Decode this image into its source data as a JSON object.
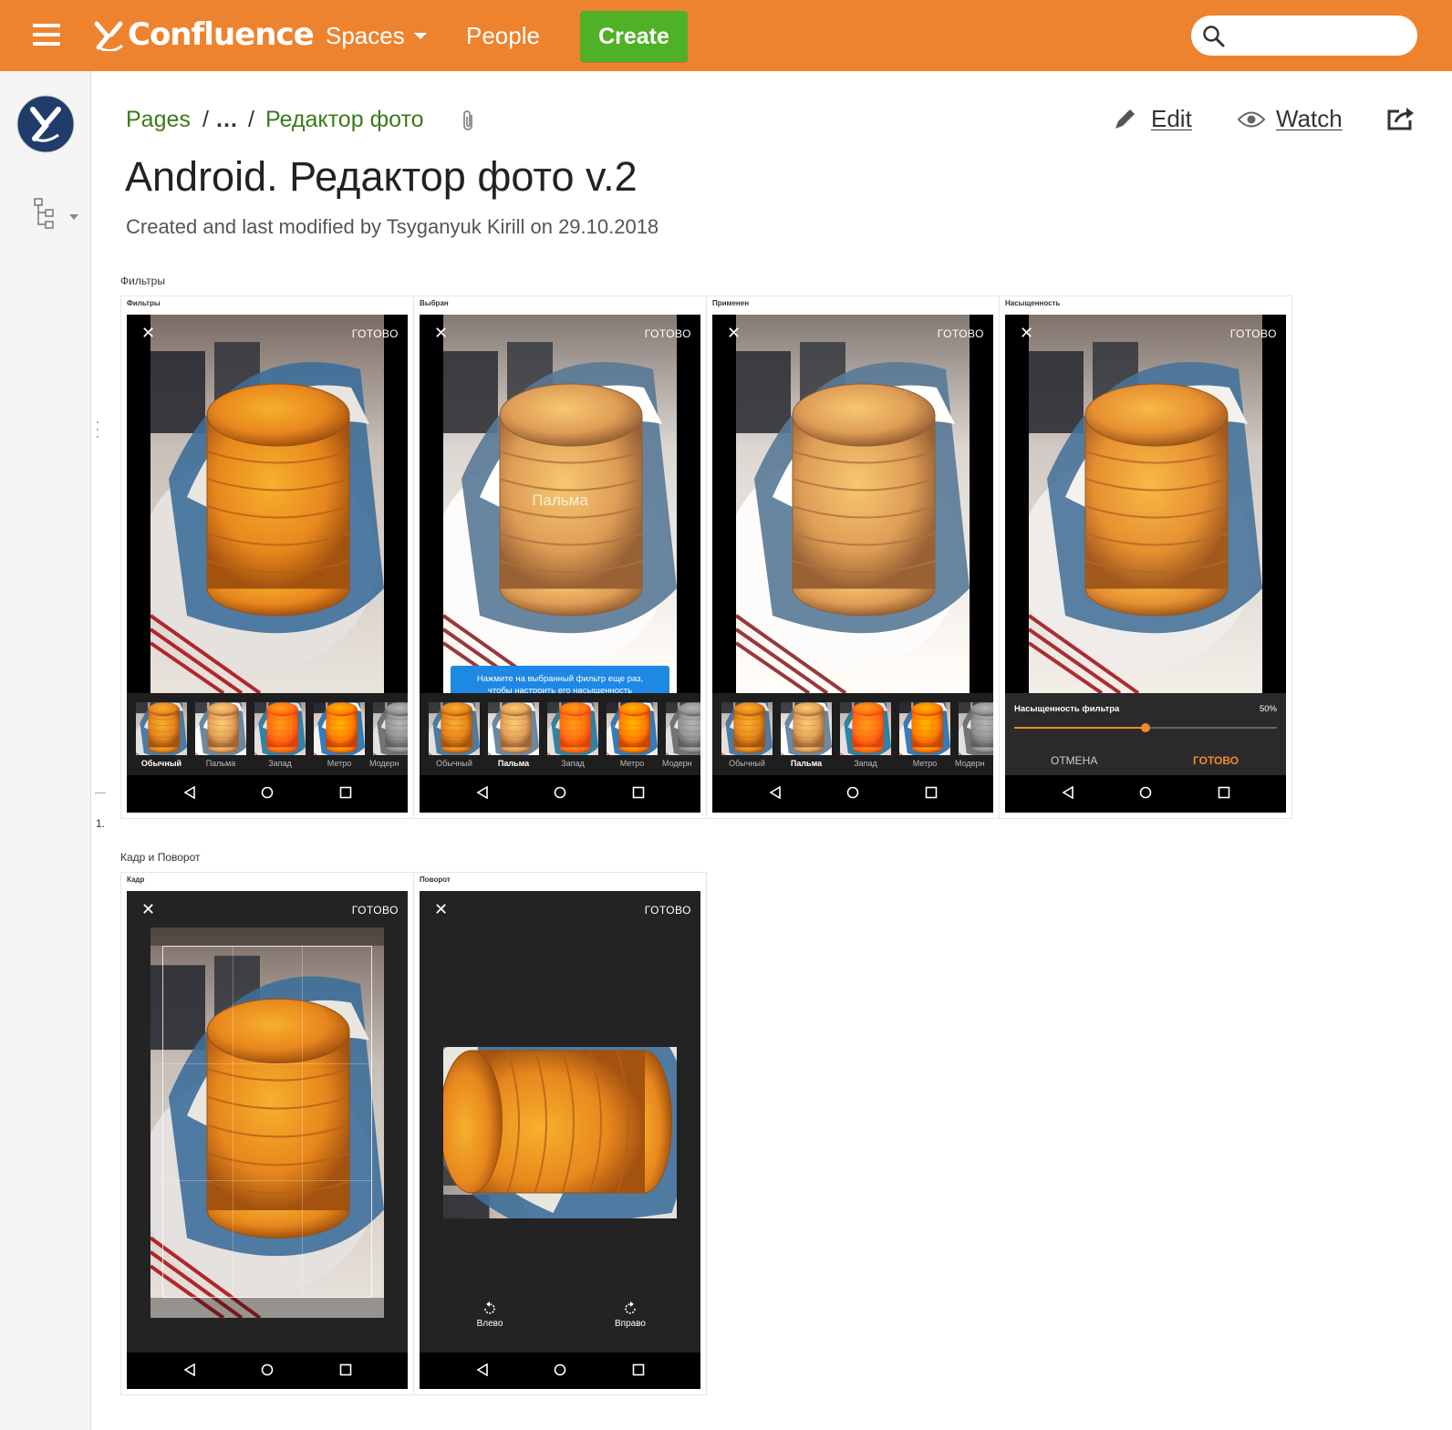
{
  "topbar": {
    "app_name": "Confluence",
    "nav": {
      "spaces": "Spaces",
      "people": "People"
    },
    "create_label": "Create",
    "search_placeholder": ""
  },
  "breadcrumb": {
    "root": "Pages",
    "sep": "/",
    "ellipsis": "…",
    "parent": "Редактор фото"
  },
  "actions": {
    "edit": "Edit",
    "watch": "Watch"
  },
  "page": {
    "title": "Android. Редактор фото v.2",
    "byline": "Created and last modified by Tsyganyuk Kirill on 29.10.2018"
  },
  "filters_section": {
    "label": "Фильтры",
    "screens": [
      {
        "title": "Фильтры",
        "close": "✕",
        "done": "ГОТОВО"
      },
      {
        "title": "Выбран",
        "close": "✕",
        "done": "ГОТОВО",
        "overlay": "Пальма",
        "tooltip_line1": "Нажмите на выбранный фильтр еще раз,",
        "tooltip_line2": "чтобы настроить его насыщенность"
      },
      {
        "title": "Применен",
        "close": "✕",
        "done": "ГОТОВО"
      },
      {
        "title": "Насыщенность",
        "close": "✕",
        "done": "ГОТОВО",
        "saturation_label": "Насыщенность фильтра",
        "saturation_value": "50%",
        "saturation_level": 0.5,
        "cancel": "ОТМЕНА",
        "ok": "ГОТОВО"
      }
    ],
    "filter_names": [
      "Обычный",
      "Пальма",
      "Запад",
      "Метро",
      "Модерн"
    ],
    "list_number": "1."
  },
  "crop_section": {
    "label": "Кадр и Поворот",
    "screens": [
      {
        "title": "Кадр",
        "close": "✕",
        "done": "ГОТОВО"
      },
      {
        "title": "Поворот",
        "close": "✕",
        "done": "ГОТОВО",
        "rotate_left": "Влево",
        "rotate_right": "Вправо"
      }
    ]
  },
  "colors": {
    "topbar": "#ee832f",
    "create": "#4fb125",
    "link": "#3b7b19",
    "accent": "#ef8a2a",
    "tooltip": "#1e88e5"
  }
}
